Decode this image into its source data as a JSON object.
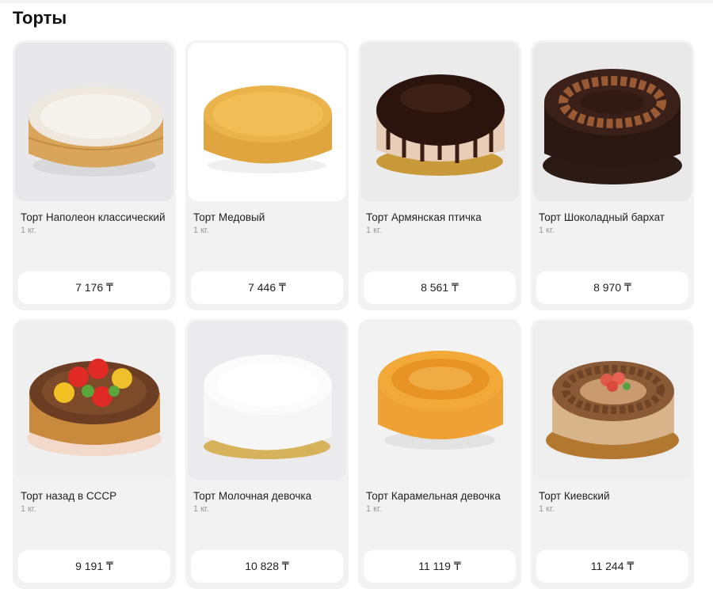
{
  "section": {
    "title": "Торты"
  },
  "currency": "₸",
  "products": [
    {
      "name": "Торт Наполеон классический",
      "weight": "1 кг.",
      "price": "7 176 ₸"
    },
    {
      "name": "Торт Медовый",
      "weight": "1 кг.",
      "price": "7 446 ₸"
    },
    {
      "name": "Торт Армянская птичка",
      "weight": "1 кг.",
      "price": "8 561 ₸"
    },
    {
      "name": "Торт Шоколадный бархат",
      "weight": "1 кг.",
      "price": "8 970 ₸"
    },
    {
      "name": "Торт назад в СССР",
      "weight": "1 кг.",
      "price": "9 191 ₸"
    },
    {
      "name": "Торт Молочная девочка",
      "weight": "1 кг.",
      "price": "10 828 ₸"
    },
    {
      "name": "Торт Карамельная девочка",
      "weight": "1 кг.",
      "price": "11 119 ₸"
    },
    {
      "name": "Торт Киевский",
      "weight": "1 кг.",
      "price": "11 244 ₸"
    }
  ],
  "colors": {
    "card_bg": "#f2f2f2",
    "button_bg": "#ffffff",
    "weight_text": "#9a9a9a"
  }
}
